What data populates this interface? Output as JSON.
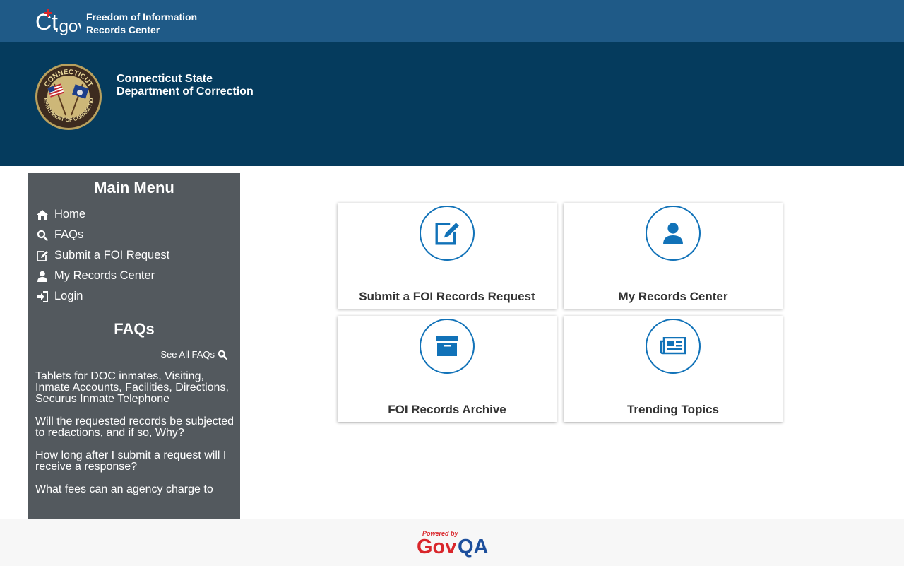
{
  "header": {
    "logo_text": "ct.gov",
    "title_line1": "Freedom of Information",
    "title_line2": "Records Center"
  },
  "banner": {
    "seal_text_top": "CONNECTICUT",
    "seal_text_bottom": "DEPARTMENT OF CORRECTION",
    "agency_line1": "Connecticut State",
    "agency_line2": "Department of Correction"
  },
  "sidebar": {
    "main_menu_title": "Main Menu",
    "menu_items": [
      {
        "label": "Home",
        "icon": "home-icon"
      },
      {
        "label": "FAQs",
        "icon": "search-icon"
      },
      {
        "label": "Submit a FOI Request",
        "icon": "edit-icon"
      },
      {
        "label": "My Records Center",
        "icon": "user-icon"
      },
      {
        "label": "Login",
        "icon": "login-icon"
      }
    ],
    "faqs_title": "FAQs",
    "see_all_label": "See All FAQs",
    "faqs": [
      "Tablets for DOC inmates, Visiting, Inmate Accounts, Facilities, Directions, Securus Inmate Telephone",
      "Will the requested records be subjected to redactions, and if so, Why?",
      "How long after I submit a request will I receive a response?",
      "What fees can an agency charge to"
    ]
  },
  "tiles": [
    {
      "label": "Submit a FOI Records Request",
      "icon": "edit-icon"
    },
    {
      "label": "My Records Center",
      "icon": "user-icon"
    },
    {
      "label": "FOI Records Archive",
      "icon": "archive-box-icon"
    },
    {
      "label": "Trending Topics",
      "icon": "newspaper-icon"
    }
  ],
  "footer": {
    "powered_by": "Powered by",
    "brand": "GovQA"
  },
  "colors": {
    "topbar": "#1f5a87",
    "banner": "#053b5d",
    "sidebar": "#53595e",
    "accent": "#1172b8",
    "govqa_red": "#d9262b",
    "govqa_blue": "#1d4f9c"
  }
}
